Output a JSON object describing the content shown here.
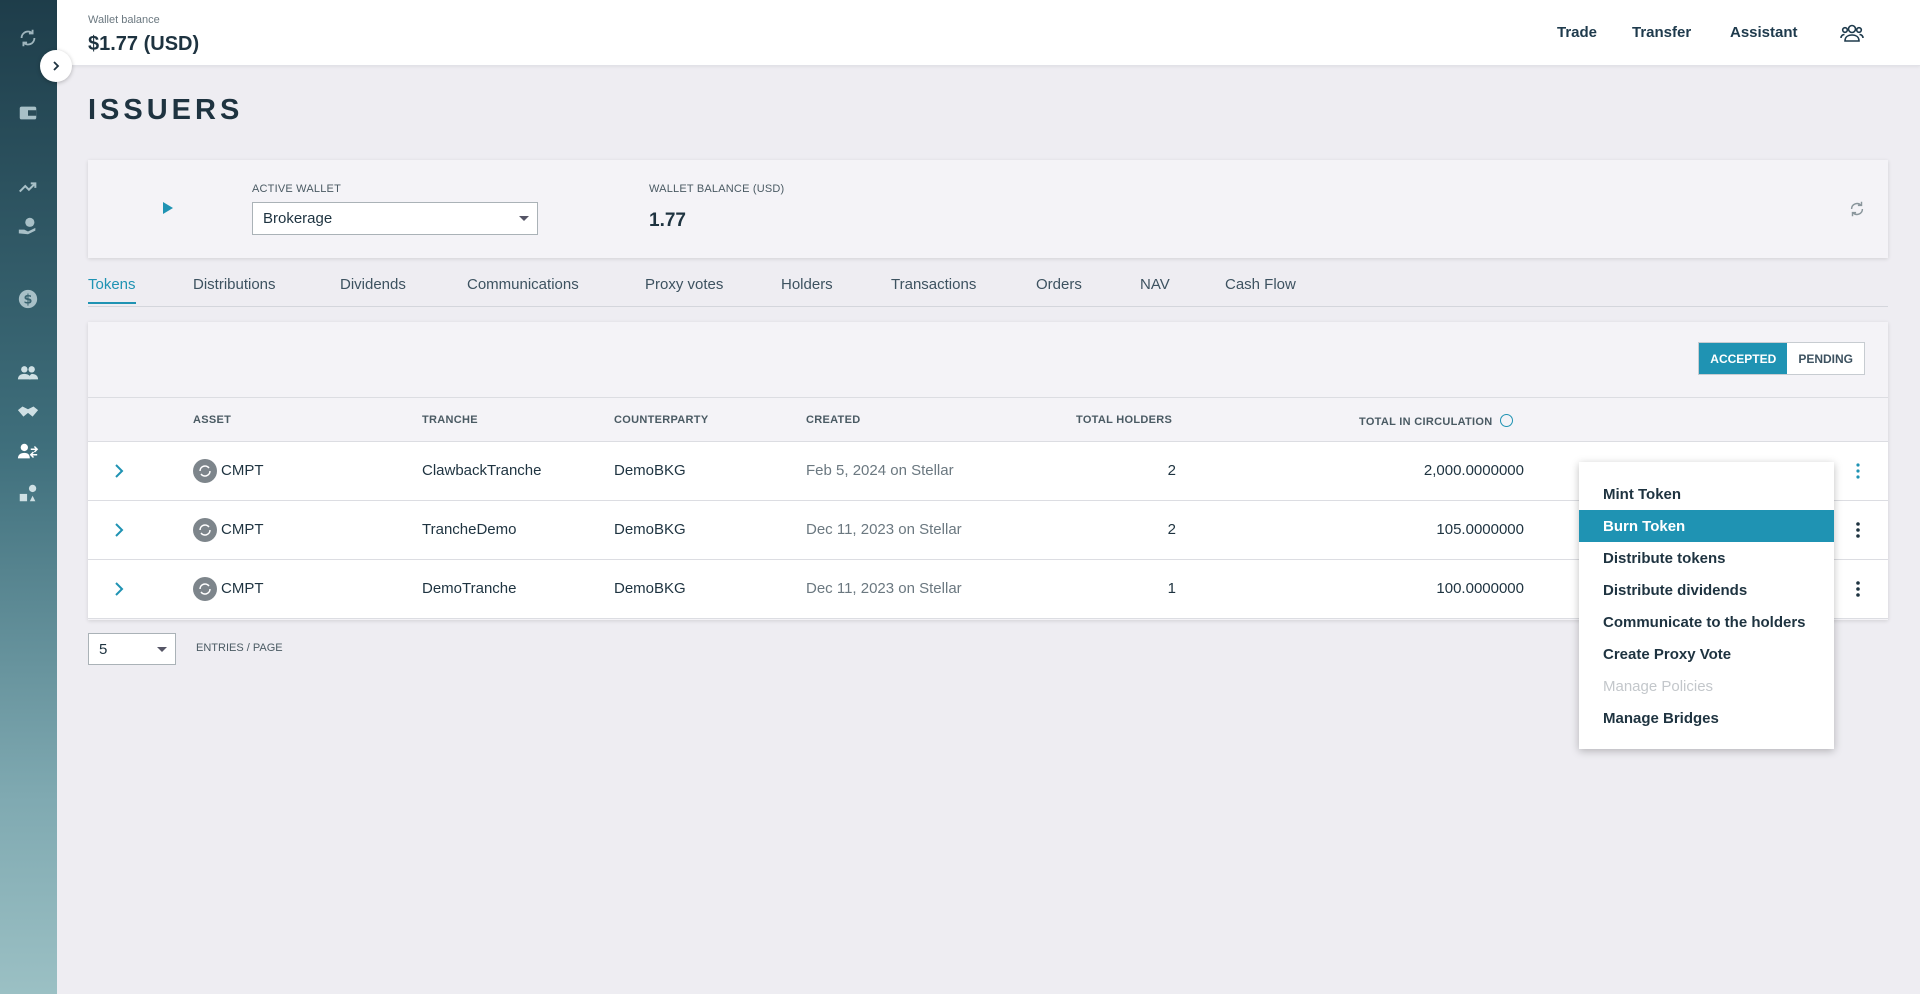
{
  "header": {
    "balance_label": "Wallet balance",
    "balance_value": "$1.77 (USD)",
    "nav": [
      "Trade",
      "Transfer",
      "Assistant"
    ]
  },
  "page_title": "ISSUERS",
  "wallet": {
    "active_label": "ACTIVE WALLET",
    "active_value": "Brokerage",
    "balance_label": "WALLET BALANCE (USD)",
    "balance_value": "1.77"
  },
  "tabs": [
    "Tokens",
    "Distributions",
    "Dividends",
    "Communications",
    "Proxy votes",
    "Holders",
    "Transactions",
    "Orders",
    "NAV",
    "Cash Flow"
  ],
  "status_toggle": {
    "accepted": "ACCEPTED",
    "pending": "PENDING"
  },
  "table": {
    "headers": [
      "ASSET",
      "TRANCHE",
      "COUNTERPARTY",
      "CREATED",
      "TOTAL HOLDERS",
      "TOTAL IN CIRCULATION"
    ],
    "rows": [
      {
        "asset": "CMPT",
        "tranche": "ClawbackTranche",
        "counterparty": "DemoBKG",
        "created": "Feb 5, 2024 on Stellar",
        "holders": "2",
        "circulation": "2,000.0000000"
      },
      {
        "asset": "CMPT",
        "tranche": "TrancheDemo",
        "counterparty": "DemoBKG",
        "created": "Dec 11, 2023 on Stellar",
        "holders": "2",
        "circulation": "105.0000000"
      },
      {
        "asset": "CMPT",
        "tranche": "DemoTranche",
        "counterparty": "DemoBKG",
        "created": "Dec 11, 2023 on Stellar",
        "holders": "1",
        "circulation": "100.0000000"
      }
    ]
  },
  "pagination": {
    "page_size": "5",
    "label": "ENTRIES / PAGE"
  },
  "menu": {
    "items": [
      "Mint Token",
      "Burn Token",
      "Distribute tokens",
      "Distribute dividends",
      "Communicate to the holders",
      "Create Proxy Vote",
      "Manage Policies",
      "Manage Bridges"
    ]
  },
  "colors": {
    "accent": "#1f93b3",
    "text": "#1e3340"
  }
}
